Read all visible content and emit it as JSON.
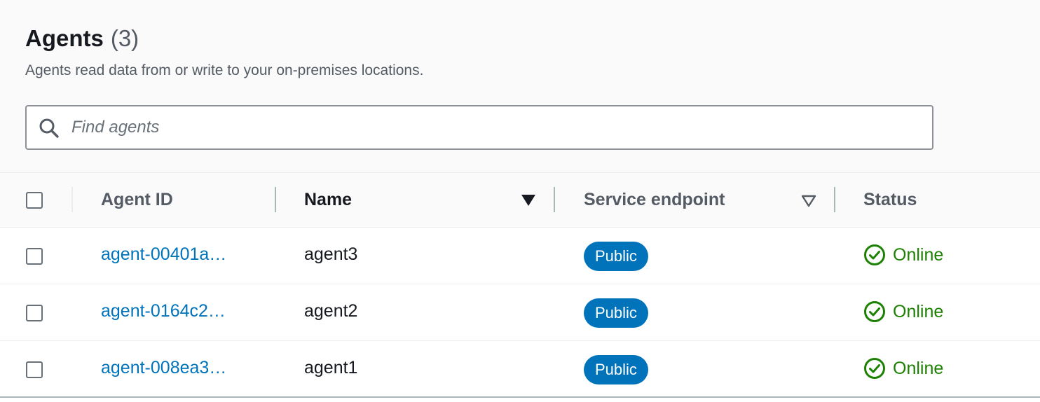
{
  "header": {
    "title": "Agents",
    "count": "(3)",
    "description": "Agents read data from or write to your on-premises locations."
  },
  "search": {
    "placeholder": "Find agents",
    "value": "",
    "icon": "search-icon"
  },
  "table": {
    "columns": [
      {
        "label": "Agent ID",
        "sortable": false
      },
      {
        "label": "Name",
        "sortable": true,
        "sort": "descending"
      },
      {
        "label": "Service endpoint",
        "sortable": true,
        "sort": "none"
      },
      {
        "label": "Status",
        "sortable": false
      }
    ],
    "rows": [
      {
        "agent_id": "agent-00401a…",
        "name": "agent3",
        "service_endpoint": "Public",
        "status": "Online"
      },
      {
        "agent_id": "agent-0164c2…",
        "name": "agent2",
        "service_endpoint": "Public",
        "status": "Online"
      },
      {
        "agent_id": "agent-008ea3…",
        "name": "agent1",
        "service_endpoint": "Public",
        "status": "Online"
      }
    ]
  },
  "colors": {
    "link": "#0073bb",
    "badge": "#0073bb",
    "status_online": "#1d8102",
    "header_bg": "#fafafa"
  }
}
